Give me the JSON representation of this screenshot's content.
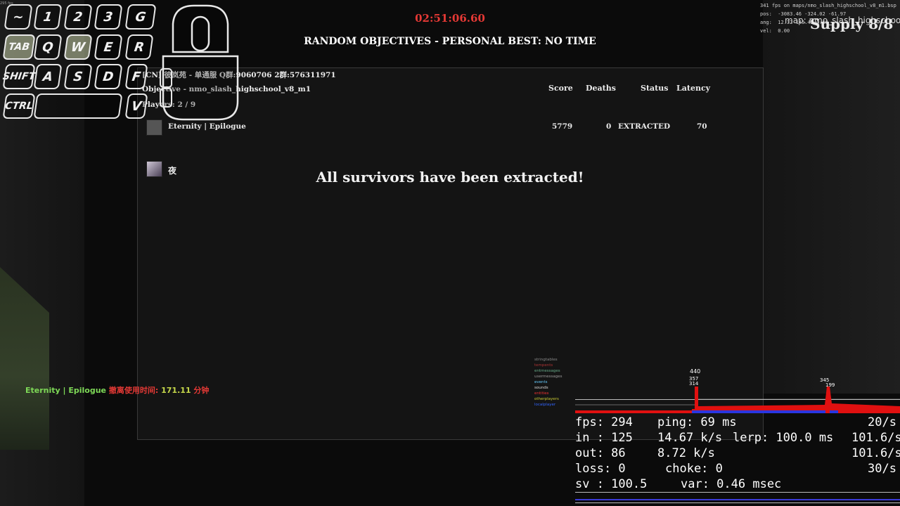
{
  "hud": {
    "timer": "02:51:06.60",
    "headline": "RANDOM OBJECTIVES - PERSONAL BEST: NO TIME",
    "extracted_message": "All survivors have been extracted!",
    "supply": "Supply 8/8",
    "map_partial": "map: nmo_slash_highschool_v",
    "corner_fps": "295 fps"
  },
  "scoreboard": {
    "server": "[CN] 彼岚苑 - 单通服 Q群:9060706 2群:576311971",
    "objective": "Objective - nmo_slash_highschool_v8_m1",
    "players": "Players: 2 / 9",
    "columns": {
      "score": "Score",
      "deaths": "Deaths",
      "status": "Status",
      "latency": "Latency"
    },
    "rows": [
      {
        "name": "Eternity | Epilogue",
        "score": "5779",
        "deaths": "0",
        "status": "EXTRACTED",
        "latency": "70"
      },
      {
        "name": "夜",
        "score": "",
        "deaths": "",
        "status": "",
        "latency": ""
      }
    ]
  },
  "keyboard": {
    "row1": [
      "~",
      "1",
      "2",
      "3",
      "G"
    ],
    "row2": [
      "TAB",
      "Q",
      "W",
      "E",
      "R"
    ],
    "row3": [
      "SHIFT",
      "A",
      "S",
      "D",
      "F"
    ],
    "row4": [
      "CTRL",
      "",
      "V"
    ],
    "pressed": [
      "TAB",
      "W"
    ]
  },
  "debug": {
    "fps_line": "341 fps on maps/nmo_slash_highschool_v8_m1.bsp",
    "pos": "pos:  -3083.46 -324.02 -61.97",
    "ang": "ang:  12.32 143.42 0.00",
    "vel": "vel:  0.00"
  },
  "chat": {
    "player": "Eternity | Epilogue",
    "label": "撤离使用时间:",
    "time": "171.11",
    "unit": "分钟",
    "colors": {
      "player": "#7ed957",
      "label": "#e53935",
      "time": "#c6d84a"
    }
  },
  "graph_legend": [
    "stringtables",
    "tempents",
    "entmessages",
    "usermessages",
    "events",
    "sounds",
    "entities",
    "otherplayers",
    "localplayer"
  ],
  "graph_labels": {
    "peak1": "440",
    "peak1b": "357",
    "peak1c": "314",
    "peak2": "345",
    "peak2b": "199"
  },
  "netgraph": {
    "fps": "fps: 294",
    "ping": "ping: 69 ms",
    "rate1": "20/s",
    "in": "in : 125",
    "in_rate": "14.67 k/s",
    "lerp": "lerp: 100.0 ms",
    "rate2": "101.6/s",
    "out": "out:  86",
    "out_rate": "8.72 k/s",
    "rate3": "101.6/s",
    "loss": "loss:  0",
    "choke": "choke:  0",
    "rate4": "30/s",
    "sv": "sv  : 100.5",
    "var": "var: 0.46 msec"
  }
}
